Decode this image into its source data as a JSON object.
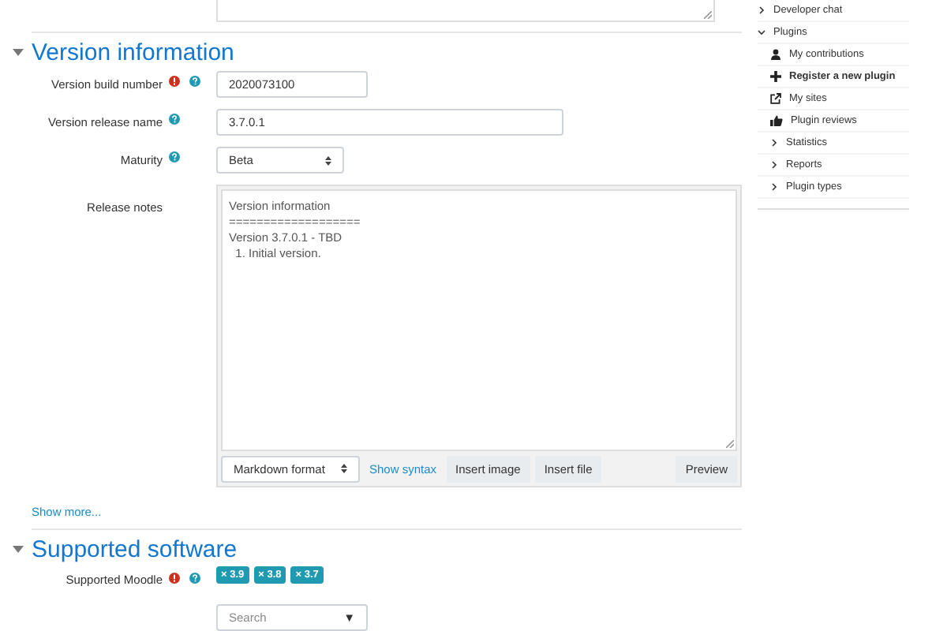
{
  "sections": [
    {
      "title": "Version information",
      "expanded": true,
      "fields": [
        {
          "kind": "number",
          "label": "Version build number",
          "required": true,
          "help": true,
          "value": "2020073100"
        },
        {
          "kind": "text",
          "label": "Version release name",
          "required": false,
          "help": true,
          "value": "3.7.0.1"
        },
        {
          "kind": "select",
          "label": "Maturity",
          "required": false,
          "help": true,
          "value": "Beta"
        },
        {
          "kind": "editor",
          "label": "Release notes",
          "required": false,
          "help": false,
          "lines": [
            "Version information",
            "===================",
            "Version 3.7.0.1 - TBD",
            "  1. Initial version."
          ],
          "format": "Markdown format",
          "syntax_link": "Show syntax",
          "buttons": [
            "Insert image",
            "Insert file"
          ],
          "preview": "Preview"
        }
      ],
      "show_more": "Show more..."
    },
    {
      "title": "Supported software",
      "expanded": true,
      "fields": [
        {
          "kind": "tags",
          "label": "Supported Moodle",
          "required": true,
          "help": true,
          "tags": [
            {
              "remove": "×",
              "text": "3.9"
            },
            {
              "remove": "×",
              "text": "3.8"
            },
            {
              "remove": "×",
              "text": "3.7"
            }
          ],
          "search": {
            "placeholder": "Search",
            "arrow": "▼"
          }
        }
      ]
    }
  ],
  "sidebar": {
    "items": [
      {
        "kind": "folder",
        "label": "Developer chat",
        "expanded": false
      },
      {
        "kind": "folder",
        "label": "Plugins",
        "expanded": true,
        "children": [
          {
            "kind": "user",
            "label": "My contributions",
            "selected": false
          },
          {
            "kind": "plus",
            "label": "Register a new plugin",
            "selected": true
          },
          {
            "kind": "external",
            "label": "My sites",
            "selected": false
          },
          {
            "kind": "thumbs",
            "label": "Plugin reviews",
            "selected": false
          },
          {
            "kind": "folder",
            "label": "Statistics",
            "expanded": false
          },
          {
            "kind": "folder",
            "label": "Reports",
            "expanded": false
          },
          {
            "kind": "folder",
            "label": "Plugin types",
            "expanded": false
          }
        ]
      }
    ]
  }
}
